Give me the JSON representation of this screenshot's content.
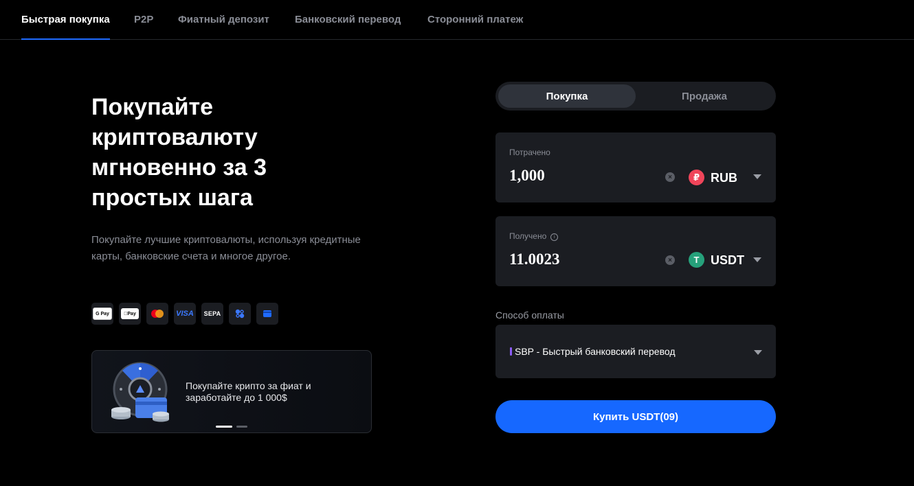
{
  "tabs": [
    {
      "label": "Быстрая покупка",
      "active": true
    },
    {
      "label": "P2P",
      "active": false
    },
    {
      "label": "Фиатный депозит",
      "active": false
    },
    {
      "label": "Банковский перевод",
      "active": false
    },
    {
      "label": "Сторонний платеж",
      "active": false
    }
  ],
  "hero": {
    "title": "Покупайте криптовалюту мгновенно за 3 простых шага",
    "subtitle": "Покупайте лучшие криптовалюты, используя кредитные карты, банковские счета и многое другое."
  },
  "payment_methods": {
    "google_pay": "G Pay",
    "apple_pay": "Pay",
    "visa": "VISA",
    "sepa": "SEPA"
  },
  "promo": {
    "text": "Покупайте крипто за фиат и заработайте до 1 000$",
    "slides_total": 2,
    "slide_active": 1
  },
  "trade_switch": {
    "buy": "Покупка",
    "sell": "Продажа",
    "active": "buy"
  },
  "spend": {
    "label": "Потрачено",
    "value": "1,000",
    "currency": "RUB",
    "currency_symbol": "₽",
    "currency_color": "#f0455a"
  },
  "receive": {
    "label": "Получено",
    "value": "11.0023",
    "currency": "USDT",
    "currency_symbol": "T",
    "currency_color": "#26a17b"
  },
  "payment": {
    "label": "Способ оплаты",
    "selected": "SBP - Быстрый банковский перевод"
  },
  "buy_button": "Купить USDT(09)",
  "colors": {
    "accent": "#1668ff",
    "panel": "#1b1d22",
    "muted_text": "#8a8d96"
  }
}
